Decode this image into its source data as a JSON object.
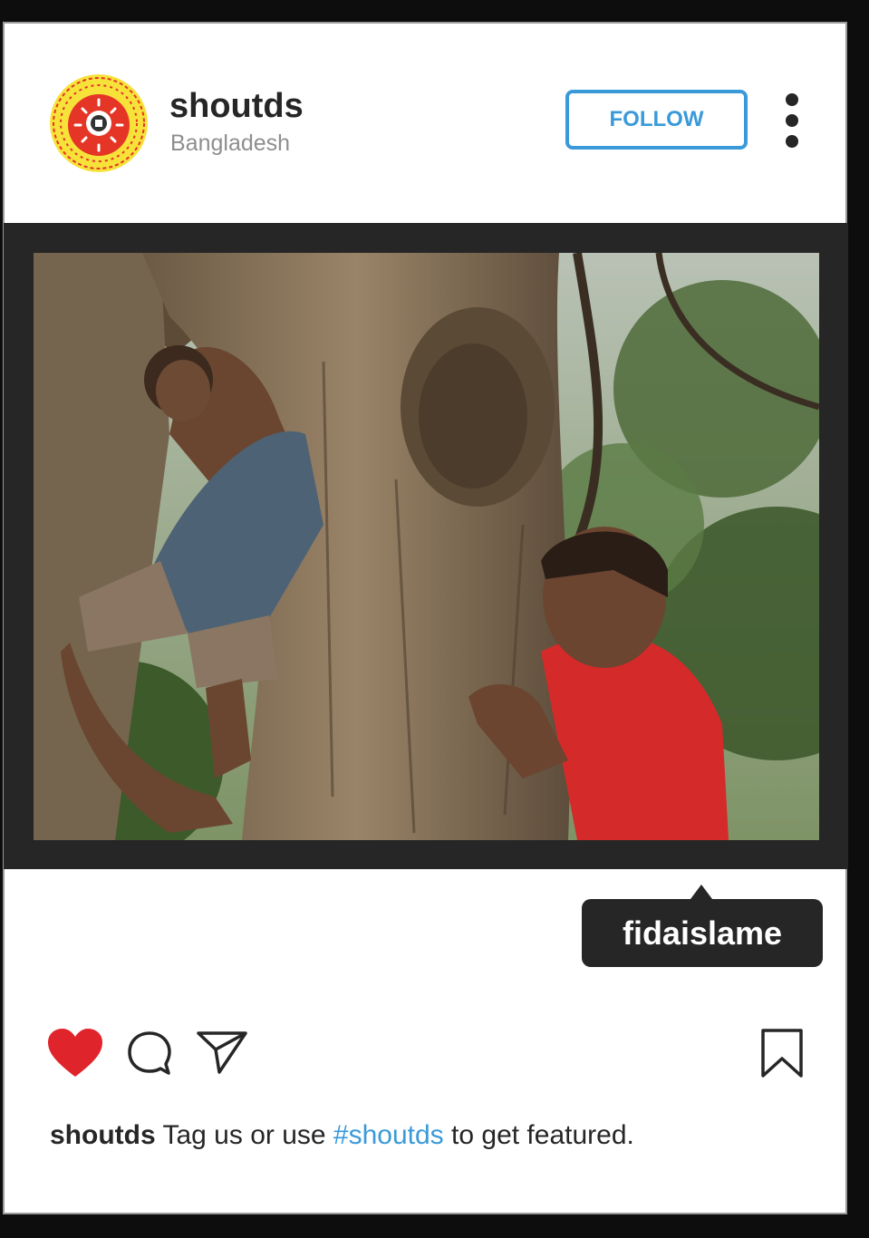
{
  "post": {
    "username": "shoutds",
    "location": "Bangladesh",
    "follow_label": "FOLLOW",
    "more_icon": "more-vertical-icon",
    "photo_description": "two-boys-with-tree-trunk",
    "tagged_user": "fidaislame"
  },
  "actions": {
    "like_icon": "heart-filled-icon",
    "comment_icon": "comment-icon",
    "share_icon": "send-icon",
    "save_icon": "bookmark-icon"
  },
  "caption": {
    "username": "shoutds",
    "text_before": "Tag us or use",
    "hashtag": "#shoutds",
    "text_after": "to get featured."
  },
  "colors": {
    "accent": "#3a9ad9",
    "like": "#e0242b",
    "frame": "#262626",
    "logo_yellow": "#f7e23a",
    "logo_red": "#e53527"
  }
}
